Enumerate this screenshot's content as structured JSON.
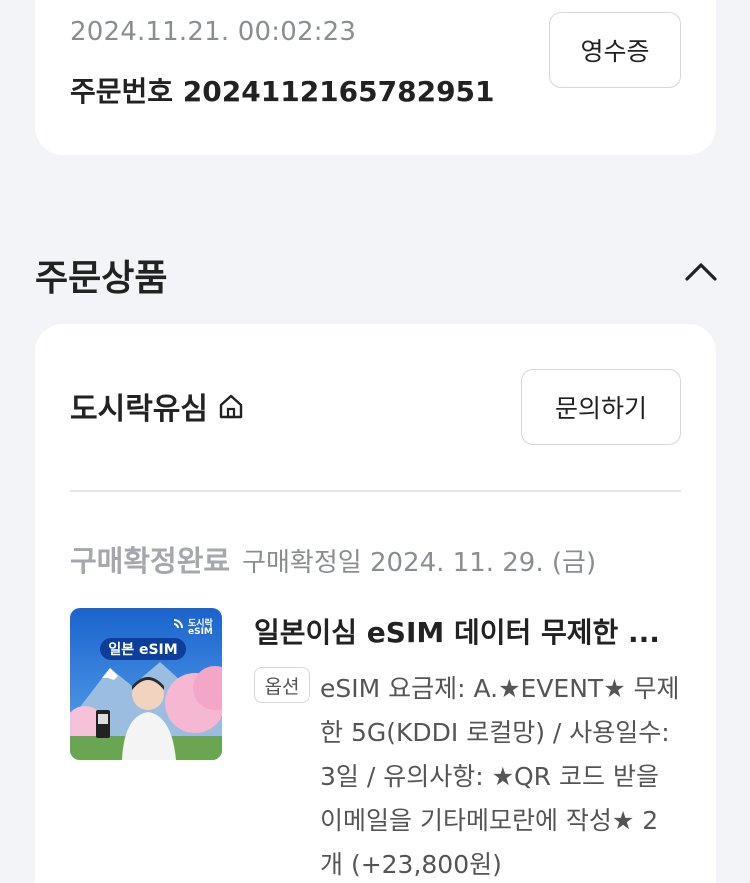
{
  "order": {
    "datetime": "2024.11.21. 00:02:23",
    "number_label": "주문번호",
    "number": "2024112165782951",
    "receipt_button": "영수증"
  },
  "section": {
    "title": "주문상품",
    "collapse_icon": "chevron-up-icon"
  },
  "seller": {
    "name": "도시락유심",
    "home_icon": "home-icon",
    "inquiry_button": "문의하기"
  },
  "item": {
    "status": "구매확정완료",
    "confirm_date": "구매확정일 2024. 11. 29. (금)",
    "thumbnail": {
      "brand_line1": "도시락",
      "brand_line2": "eSIM",
      "banner": "일본 eSIM"
    },
    "name": "일본이심 eSIM 데이터 무제한 ...",
    "option_badge": "옵션",
    "option_text": "eSIM 요금제: A.★EVENT★ 무제한 5G(KDDI 로컬망) / 사용일수: 3일 / 유의사항: ★QR 코드 받을 이메일을 기타메모란에 작성★",
    "quantity_price": "2개 (+23,800원)"
  },
  "colors": {
    "background": "#f2f4f7",
    "card": "#ffffff",
    "muted": "#8a8d92",
    "thumbnail_sky": "#1f6fd1"
  }
}
